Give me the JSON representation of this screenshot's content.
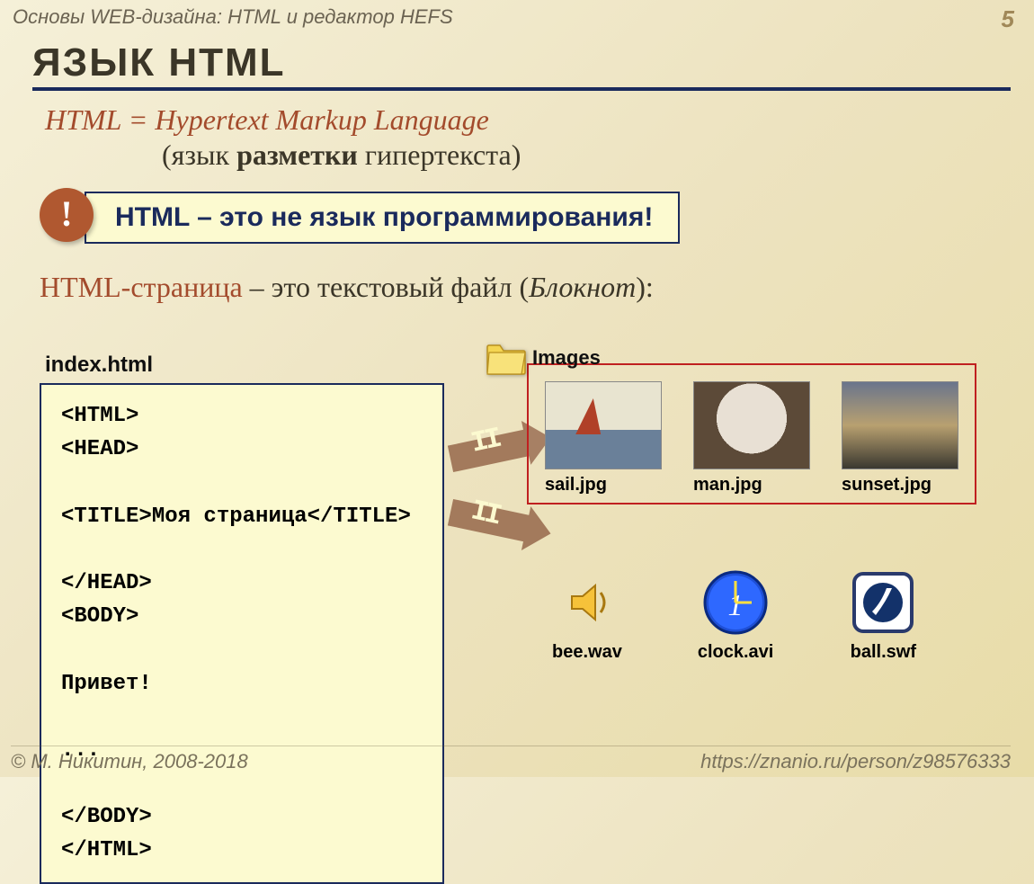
{
  "header": {
    "course_title": "Основы WEB-дизайна: HTML и редактор HEFS",
    "page_number": "5"
  },
  "section_title": "ЯЗЫК HTML",
  "definition": {
    "line1": "HTML = Hypertext Markup Language",
    "line2_open": "(язык ",
    "line2_bold": "разметки",
    "line2_close": " гипертекста)"
  },
  "callout": {
    "bang": "!",
    "text": "HTML – это не язык программирования!"
  },
  "description": {
    "red": "HTML-страница",
    "mid": " – это текстовый файл (",
    "italic": "Блокнот",
    "close": "):"
  },
  "file": {
    "name": "index.html",
    "code": "<HTML>\n<HEAD>\n\n<TITLE>Моя страница</TITLE>\n\n</HEAD>\n<BODY>\n\nПривет!\n\n...\n\n</BODY>\n</HTML>"
  },
  "images_panel": {
    "folder_label": "Images",
    "thumbs": [
      {
        "label": "sail.jpg"
      },
      {
        "label": "man.jpg"
      },
      {
        "label": "sunset.jpg"
      }
    ]
  },
  "lower_files": [
    {
      "label": "bee.wav"
    },
    {
      "label": "clock.avi"
    },
    {
      "label": "ball.swf"
    }
  ],
  "footer": {
    "author": "© М. Никитин, 2008-2018",
    "url": "https://znanio.ru/person/z98576333"
  }
}
